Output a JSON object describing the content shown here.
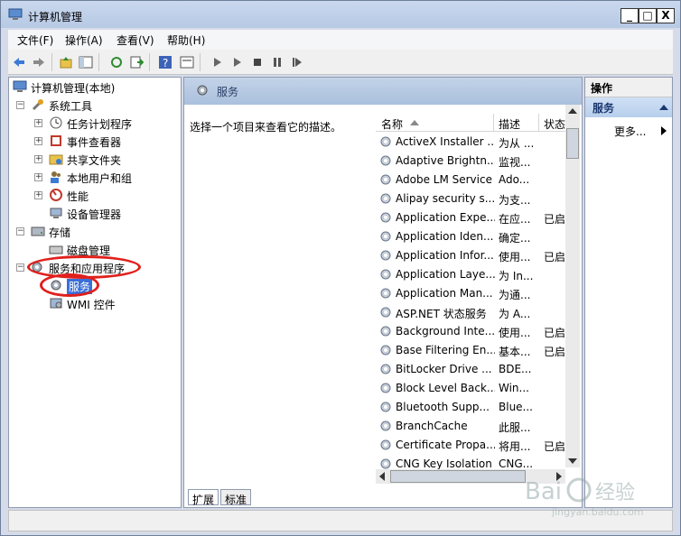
{
  "window": {
    "title": "计算机管理",
    "buttons": {
      "minimize": "_",
      "maximize": "□",
      "close": "X"
    }
  },
  "menu": [
    "文件(F)",
    "操作(A)",
    "查看(V)",
    "帮助(H)"
  ],
  "tree": {
    "root": "计算机管理(本地)",
    "system_tools": "系统工具",
    "system_children": [
      "任务计划程序",
      "事件查看器",
      "共享文件夹",
      "本地用户和组",
      "性能",
      "设备管理器"
    ],
    "storage": "存储",
    "storage_children": [
      "磁盘管理"
    ],
    "services_apps": "服务和应用程序",
    "services_children": [
      "服务",
      "WMI 控件"
    ]
  },
  "center": {
    "header": "服务",
    "description": "选择一个项目来查看它的描述。",
    "columns": {
      "name": "名称",
      "desc": "描述",
      "status": "状态"
    },
    "rows": [
      {
        "name": "ActiveX Installer ...",
        "desc": "为从 ...",
        "status": ""
      },
      {
        "name": "Adaptive Brightn...",
        "desc": "监视...",
        "status": ""
      },
      {
        "name": "Adobe LM Service",
        "desc": "Ado...",
        "status": ""
      },
      {
        "name": "Alipay security s...",
        "desc": "为支...",
        "status": ""
      },
      {
        "name": "Application Expe...",
        "desc": "在应...",
        "status": "已启"
      },
      {
        "name": "Application Iden...",
        "desc": "确定...",
        "status": ""
      },
      {
        "name": "Application Infor...",
        "desc": "使用...",
        "status": "已启"
      },
      {
        "name": "Application Laye...",
        "desc": "为 In...",
        "status": ""
      },
      {
        "name": "Application Man...",
        "desc": "为通...",
        "status": ""
      },
      {
        "name": "ASP.NET 状态服务",
        "desc": "为 A...",
        "status": ""
      },
      {
        "name": "Background Inte...",
        "desc": "使用...",
        "status": "已启"
      },
      {
        "name": "Base Filtering En...",
        "desc": "基本...",
        "status": "已启"
      },
      {
        "name": "BitLocker Drive ...",
        "desc": "BDE...",
        "status": ""
      },
      {
        "name": "Block Level Back...",
        "desc": "Win...",
        "status": ""
      },
      {
        "name": "Bluetooth Supp...",
        "desc": "Blue...",
        "status": ""
      },
      {
        "name": "BranchCache",
        "desc": "此服...",
        "status": ""
      },
      {
        "name": "Certificate Propa...",
        "desc": "将用...",
        "status": "已启"
      },
      {
        "name": "CNG Key Isolation",
        "desc": "CNG...",
        "status": ""
      }
    ],
    "tabs": [
      "扩展",
      "标准"
    ]
  },
  "actions": {
    "header": "操作",
    "selected": "服务",
    "more": "更多..."
  },
  "watermark": {
    "text": "Bai 经验",
    "sub": "jingyan.baidu.com"
  },
  "colors": {
    "annotation": "#e0201c",
    "header_bg": "#b7c9e4",
    "selection": "#3a6fd8"
  }
}
